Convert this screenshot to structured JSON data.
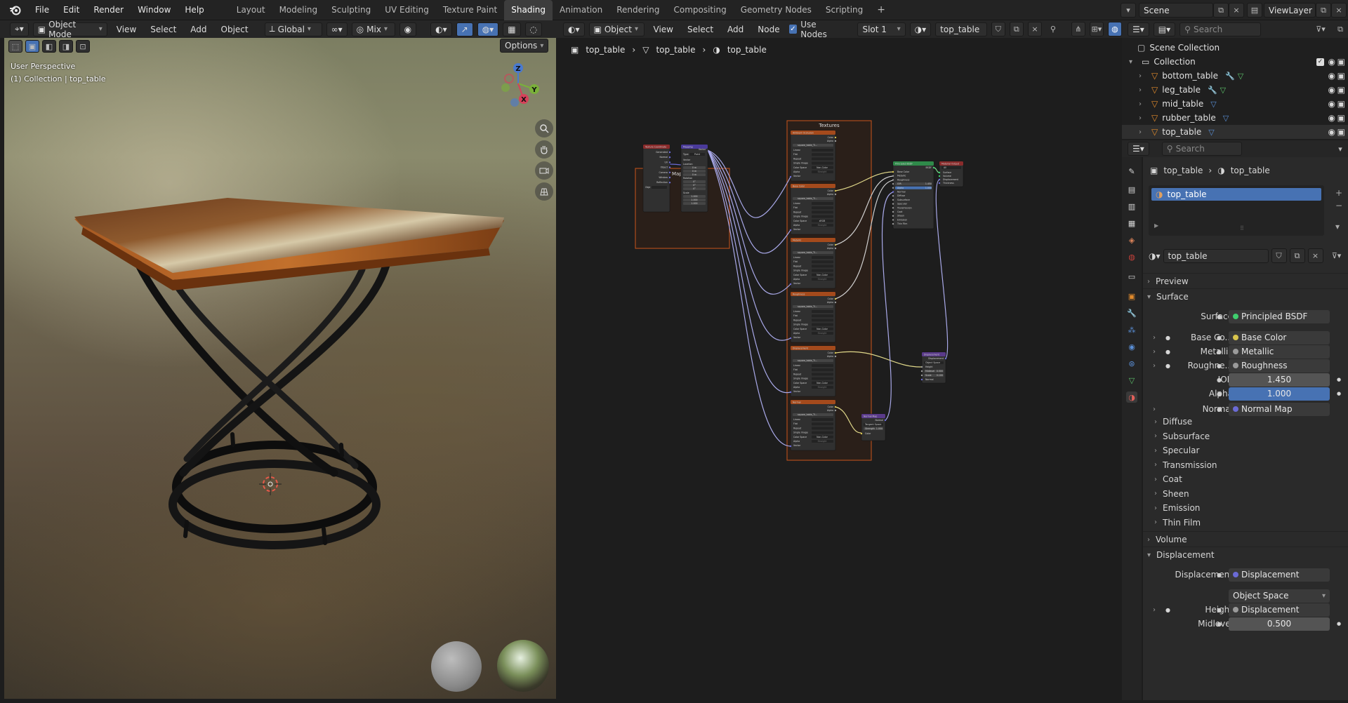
{
  "menu": [
    "File",
    "Edit",
    "Render",
    "Window",
    "Help"
  ],
  "workspaces": [
    "Layout",
    "Modeling",
    "Sculpting",
    "UV Editing",
    "Texture Paint",
    "Shading",
    "Animation",
    "Rendering",
    "Compositing",
    "Geometry Nodes",
    "Scripting",
    "+"
  ],
  "active_workspace": "Shading",
  "scene": {
    "name": "Scene",
    "view_layer": "ViewLayer"
  },
  "viewport": {
    "mode": "Object Mode",
    "menus": [
      "View",
      "Select",
      "Add",
      "Object"
    ],
    "orientation": "Global",
    "shading_mix": "Mix",
    "options_label": "Options",
    "overlay_line1": "User Perspective",
    "overlay_line2": "(1) Collection | top_table",
    "gizmo": {
      "z": "Z",
      "y": "Y",
      "x": "X"
    }
  },
  "node_editor": {
    "type": "Object",
    "menus": [
      "View",
      "Select",
      "Add",
      "Node"
    ],
    "use_nodes_label": "Use Nodes",
    "slot": "Slot 1",
    "material": "top_table",
    "breadcrumb": [
      "top_table",
      "top_table",
      "top_table"
    ],
    "frames": {
      "mapping": "Mapping",
      "textures": "Textures"
    },
    "nodes": {
      "texcoord": {
        "title": "Texture Coordinate",
        "outputs": [
          "Generated",
          "Normal",
          "UV",
          "Object",
          "Camera",
          "Window",
          "Reflection"
        ],
        "obj_label": "Obje"
      },
      "mapping": {
        "title": "Mapping",
        "type_label": "Type:",
        "type_value": "Point",
        "vector": "Vector",
        "location": "Location",
        "rotation": "Rotation",
        "scale": "Scale",
        "loc_vals": [
          "0 m",
          "0 m",
          "0 m"
        ],
        "rot_vals": [
          "0°",
          "0°",
          "0°"
        ],
        "scale_vals": [
          "1.000",
          "1.000",
          "1.000"
        ]
      },
      "tex_titles": [
        "Ambient Occlusion",
        "Base Color",
        "Metallic",
        "Roughness",
        "Displacement",
        "Normal"
      ],
      "tex_image": "square_table_Ti...",
      "tex_rows": [
        "Linear",
        "Flat",
        "Repeat",
        "Single Image",
        "Color Space",
        "Alpha",
        "Vector"
      ],
      "tex_colorspace": [
        "Non-Color",
        "sRGB",
        "Non-Color",
        "Non-Color",
        "Non-Color",
        "Non-Color"
      ],
      "tex_alpha": "Straight",
      "bsdf": {
        "title": "Principled BSDF",
        "out": "BSDF",
        "inputs": [
          "Base Color",
          "Metallic",
          "Roughness",
          "IOR",
          "Alpha",
          "Normal",
          "Diffuse",
          "Subsurface",
          "Specular",
          "Transmission",
          "Coat",
          "Sheen",
          "Emission",
          "Thin Film"
        ],
        "ior": "1.450",
        "alpha": "1.000"
      },
      "output": {
        "title": "Material Output",
        "target": "All",
        "inputs": [
          "Surface",
          "Volume",
          "Displacement",
          "Thickness"
        ]
      },
      "displacement": {
        "title": "Displacement",
        "out": "Displacement",
        "space": "Object Space",
        "inputs": [
          "Height",
          "Midlevel",
          "Scale",
          "Normal"
        ],
        "midlevel": "0.500",
        "scale": "0.100"
      },
      "normalmap": {
        "title": "Normal Map",
        "out": "Normal",
        "space": "Tangent Space",
        "strength": "Strength",
        "strength_val": "1.000",
        "color": "Color"
      }
    }
  },
  "outliner": {
    "search_placeholder": "Search",
    "scene_collection": "Scene Collection",
    "collection": "Collection",
    "items": [
      "bottom_table",
      "leg_table",
      "mid_table",
      "rubber_table",
      "top_table"
    ]
  },
  "properties": {
    "search_placeholder": "Search",
    "breadcrumb": [
      "top_table",
      "top_table"
    ],
    "slot_item": "top_table",
    "material_name": "top_table",
    "sections": {
      "preview": "Preview",
      "surface": "Surface",
      "volume": "Volume",
      "displacement": "Displacement"
    },
    "surface_rows": [
      {
        "label": "Surface",
        "value": "Principled BSDF",
        "dot": "#3fcf6e"
      },
      {
        "label": "Base Co...",
        "value": "Base Color",
        "dot": "#d8c44c"
      },
      {
        "label": "Metallic",
        "value": "Metallic",
        "dot": "#9a9a9a"
      },
      {
        "label": "Roughne...",
        "value": "Roughness",
        "dot": "#9a9a9a"
      }
    ],
    "ior": {
      "label": "IOR",
      "value": "1.450"
    },
    "alpha": {
      "label": "Alpha",
      "value": "1.000"
    },
    "normal": {
      "label": "Normal",
      "value": "Normal Map",
      "dot": "#6b6bd6"
    },
    "subsections": [
      "Diffuse",
      "Subsurface",
      "Specular",
      "Transmission",
      "Coat",
      "Sheen",
      "Emission",
      "Thin Film"
    ],
    "disp_row": {
      "label": "Displacement",
      "value": "Displacement",
      "dot": "#6b6bd6"
    },
    "disp_space": "Object Space",
    "height": {
      "label": "Height",
      "value": "Displacement",
      "dot": "#9a9a9a"
    },
    "midlevel": {
      "label": "Midlevel",
      "value": "0.500"
    }
  },
  "colors": {
    "accent": "#4772b3",
    "node_orange": "#d26a2a",
    "bsdf_green": "#2f8a4a",
    "vector_purple": "#5a4aa0"
  }
}
